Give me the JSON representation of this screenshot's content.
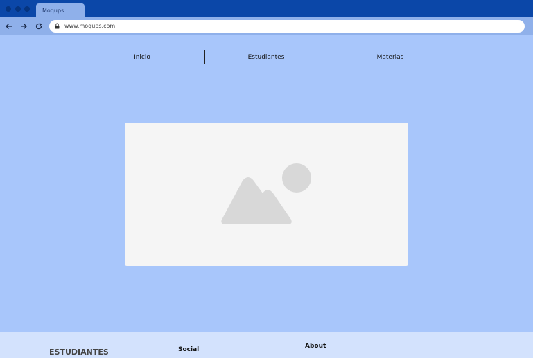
{
  "browser": {
    "tab_title": "Moqups",
    "url": "www.moqups.com",
    "colors": {
      "titlebar": "#0b47a8",
      "toolbar": "#8fb0ea"
    }
  },
  "nav": {
    "items": [
      {
        "label": "Inicio"
      },
      {
        "label": "Estudiantes"
      },
      {
        "label": "Materias"
      }
    ]
  },
  "hero": {
    "image_icon": "image-placeholder-icon"
  },
  "footer": {
    "brand": "ESTUDIANTES",
    "social_heading": "Social",
    "about_heading": "About"
  },
  "colors": {
    "page_bg": "#a8c6fb",
    "footer_bg": "#d3e2fd",
    "placeholder_bg": "#f5f5f5"
  }
}
